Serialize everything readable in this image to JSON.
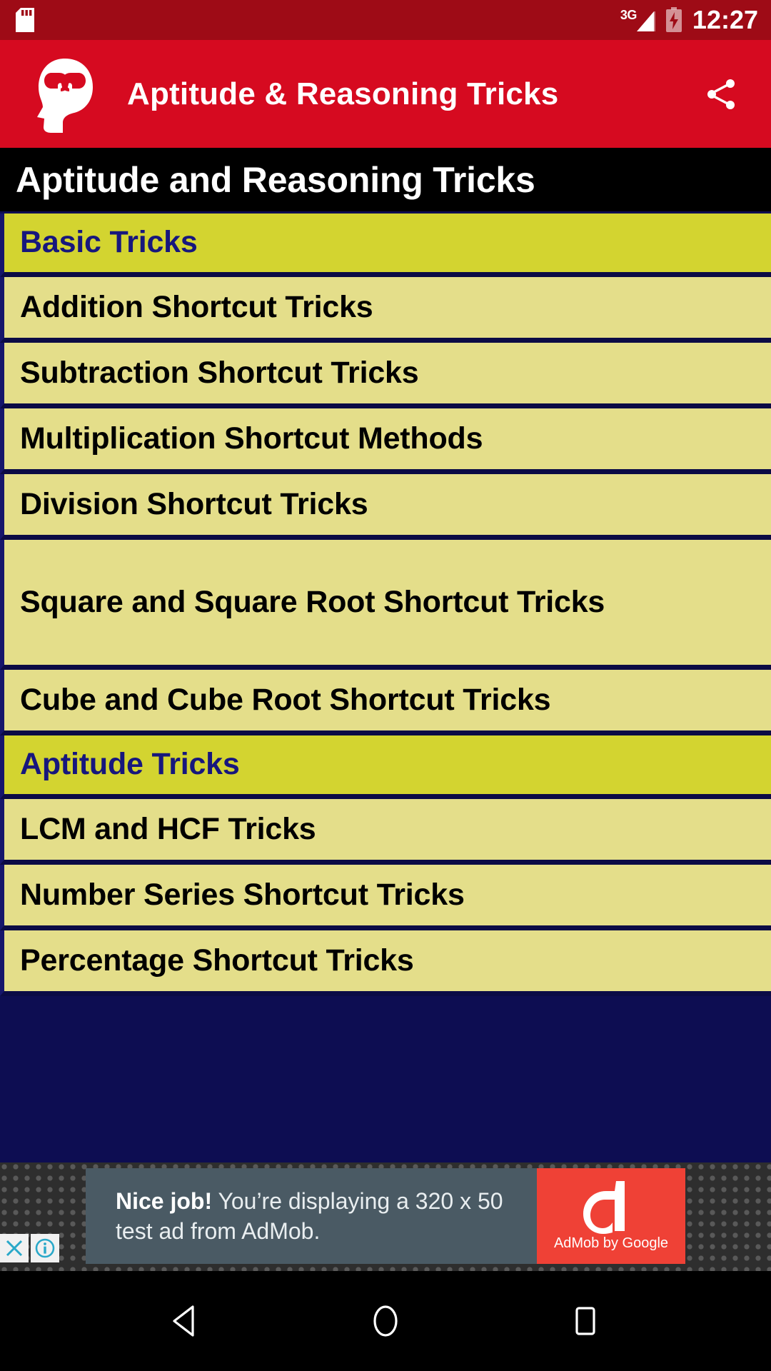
{
  "status_bar": {
    "sd_card_icon": "sd-card-icon",
    "network_label": "3G",
    "signal_icon": "signal-bars-icon",
    "battery_icon": "battery-charging-icon",
    "clock": "12:27",
    "background_color": "#9e0b16"
  },
  "app_bar": {
    "logo_icon": "brain-head-logo-icon",
    "title": "Aptitude & Reasoning Tricks",
    "share_icon": "share-icon",
    "background_color": "#d60a20"
  },
  "page_heading": {
    "title": "Aptitude and Reasoning Tricks",
    "background_color": "#000000",
    "text_color": "#ffffff"
  },
  "list": {
    "section_bg": "#d3d430",
    "section_text": "#17177d",
    "item_bg": "#e4de8a",
    "item_text": "#000000",
    "divider": "#0b0b45",
    "items": [
      {
        "label": "Basic Tricks",
        "type": "section",
        "height": "row-h1"
      },
      {
        "label": "Addition Shortcut Tricks",
        "type": "item",
        "height": "row-h2"
      },
      {
        "label": "Subtraction Shortcut Tricks",
        "type": "item",
        "height": "row-h2"
      },
      {
        "label": "Multiplication Shortcut Methods",
        "type": "item",
        "height": "row-h2"
      },
      {
        "label": "Division Shortcut Tricks",
        "type": "item",
        "height": "row-h2"
      },
      {
        "label": "Square and Square Root Shortcut Tricks",
        "type": "item",
        "height": "row-h-tall"
      },
      {
        "label": "Cube and Cube Root Shortcut Tricks",
        "type": "item",
        "height": "row-h2"
      },
      {
        "label": "Aptitude Tricks",
        "type": "section",
        "height": "row-h1"
      },
      {
        "label": "LCM and HCF Tricks",
        "type": "item",
        "height": "row-h2"
      },
      {
        "label": "Number Series Shortcut Tricks",
        "type": "item",
        "height": "row-h2"
      },
      {
        "label": "Percentage Shortcut Tricks",
        "type": "item",
        "height": "row-h2"
      }
    ]
  },
  "ad": {
    "headline": "Nice job!",
    "body": " You’re displaying a 320 x 50 test ad from AdMob.",
    "brand_caption": "AdMob by Google",
    "brand_icon": "admob-logo-icon",
    "close_icon": "close-icon",
    "info_icon": "info-icon",
    "panel_color": "#4a5a64",
    "brand_color": "#ef4136"
  },
  "nav_bar": {
    "back_icon": "back-triangle-icon",
    "home_icon": "home-circle-icon",
    "recents_icon": "recents-square-icon",
    "background_color": "#000000"
  }
}
